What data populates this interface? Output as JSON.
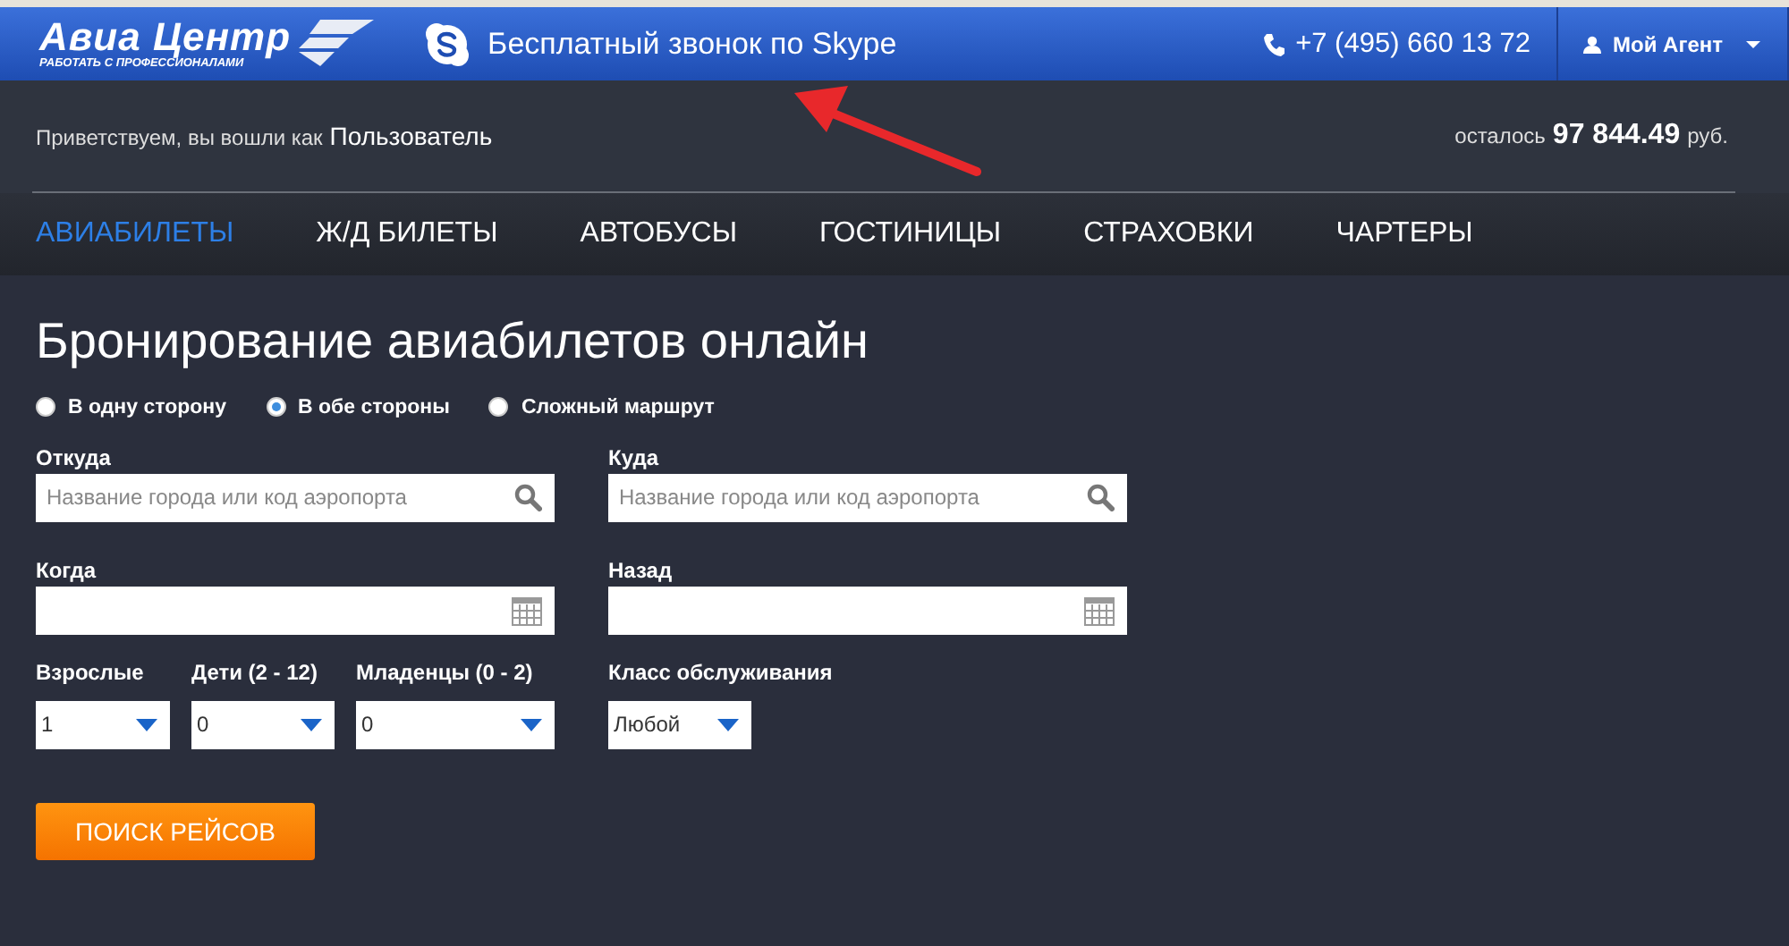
{
  "header": {
    "logo_title": "Авиа Центр",
    "logo_tagline": "РАБОТАТЬ С ПРОФЕССИОНАЛАМИ",
    "skype_text": "Бесплатный звонок по Skype",
    "phone": "+7 (495) 660 13 72",
    "account_menu": "Мой Агент"
  },
  "welcome": {
    "greeting": "Приветствуем, вы вошли как",
    "user": "Пользователь",
    "balance_prefix": "осталось",
    "balance": "97 844.49",
    "balance_suffix": "руб."
  },
  "nav": [
    {
      "label": "АВИАБИЛЕТЫ",
      "selected": true
    },
    {
      "label": "Ж/Д БИЛЕТЫ",
      "selected": false
    },
    {
      "label": "АВТОБУСЫ",
      "selected": false
    },
    {
      "label": "ГОСТИНИЦЫ",
      "selected": false
    },
    {
      "label": "СТРАХОВКИ",
      "selected": false
    },
    {
      "label": "ЧАРТЕРЫ",
      "selected": false
    }
  ],
  "form": {
    "title": "Бронирование авиабилетов онлайн",
    "trip_types": [
      {
        "label": "В одну сторону",
        "selected": false
      },
      {
        "label": "В обе стороны",
        "selected": true
      },
      {
        "label": "Сложный маршрут",
        "selected": false
      }
    ],
    "from": {
      "label": "Откуда",
      "placeholder": "Название города или код аэропорта"
    },
    "to": {
      "label": "Куда",
      "placeholder": "Название города или код аэропорта"
    },
    "depart": {
      "label": "Когда"
    },
    "return": {
      "label": "Назад"
    },
    "passengers": [
      {
        "label": "Взрослые",
        "value": "1"
      },
      {
        "label": "Дети (2 - 12)",
        "value": "0"
      },
      {
        "label": "Младенцы (0 - 2)",
        "value": "0"
      }
    ],
    "service_class": {
      "label": "Класс обслуживания",
      "value": "Любой"
    },
    "submit": "ПОИСК РЕЙСОВ"
  }
}
